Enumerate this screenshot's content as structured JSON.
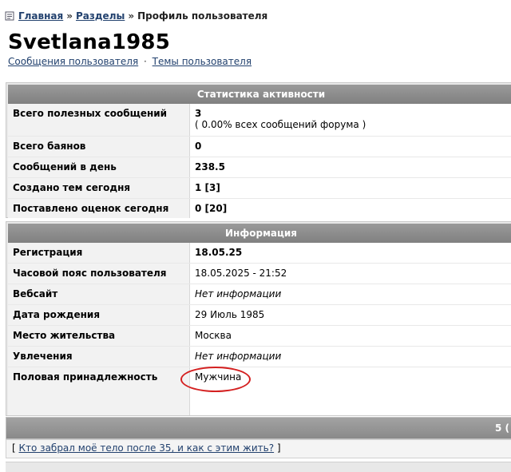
{
  "breadcrumb": {
    "home": "Главная",
    "separator": "»",
    "sections": "Разделы",
    "current": "Профиль пользователя"
  },
  "profile": {
    "username": "Svetlana1985",
    "links": {
      "messages": "Сообщения пользователя",
      "dot": "·",
      "topics": "Темы пользователя"
    }
  },
  "stats": {
    "header": "Статистика активности",
    "rows": [
      {
        "label": "Всего полезных сообщений",
        "value": "3",
        "sub": "( 0.00% всех сообщений форума )"
      },
      {
        "label": "Всего баянов",
        "value": "0"
      },
      {
        "label": "Сообщений в день",
        "value": "238.5"
      },
      {
        "label": "Создано тем сегодня",
        "value": "1 [3]"
      },
      {
        "label": "Поставлено оценок сегодня",
        "value": "0 [20]"
      }
    ]
  },
  "info": {
    "header": "Информация",
    "rows": [
      {
        "label": "Регистрация",
        "value": "18.05.25"
      },
      {
        "label": "Часовой пояс пользователя",
        "value": "18.05.2025 - 21:52"
      },
      {
        "label": "Вебсайт",
        "value": "Нет информации"
      },
      {
        "label": "Дата рождения",
        "value": "29 Июль 1985"
      },
      {
        "label": "Место жительства",
        "value": "Москва"
      },
      {
        "label": "Увлечения",
        "value": "Нет информации"
      },
      {
        "label": "Половая принадлежность",
        "value": "Мужчина"
      }
    ]
  },
  "footer": {
    "count": "5 (",
    "topic_open": "[",
    "topic_link": "Кто забрал моё тело после 35, и как с этим жить?",
    "topic_close": "]"
  },
  "colors": {
    "link": "#22416e",
    "header_bar": "#8a8a8a",
    "highlight_ellipse": "#d42020"
  }
}
